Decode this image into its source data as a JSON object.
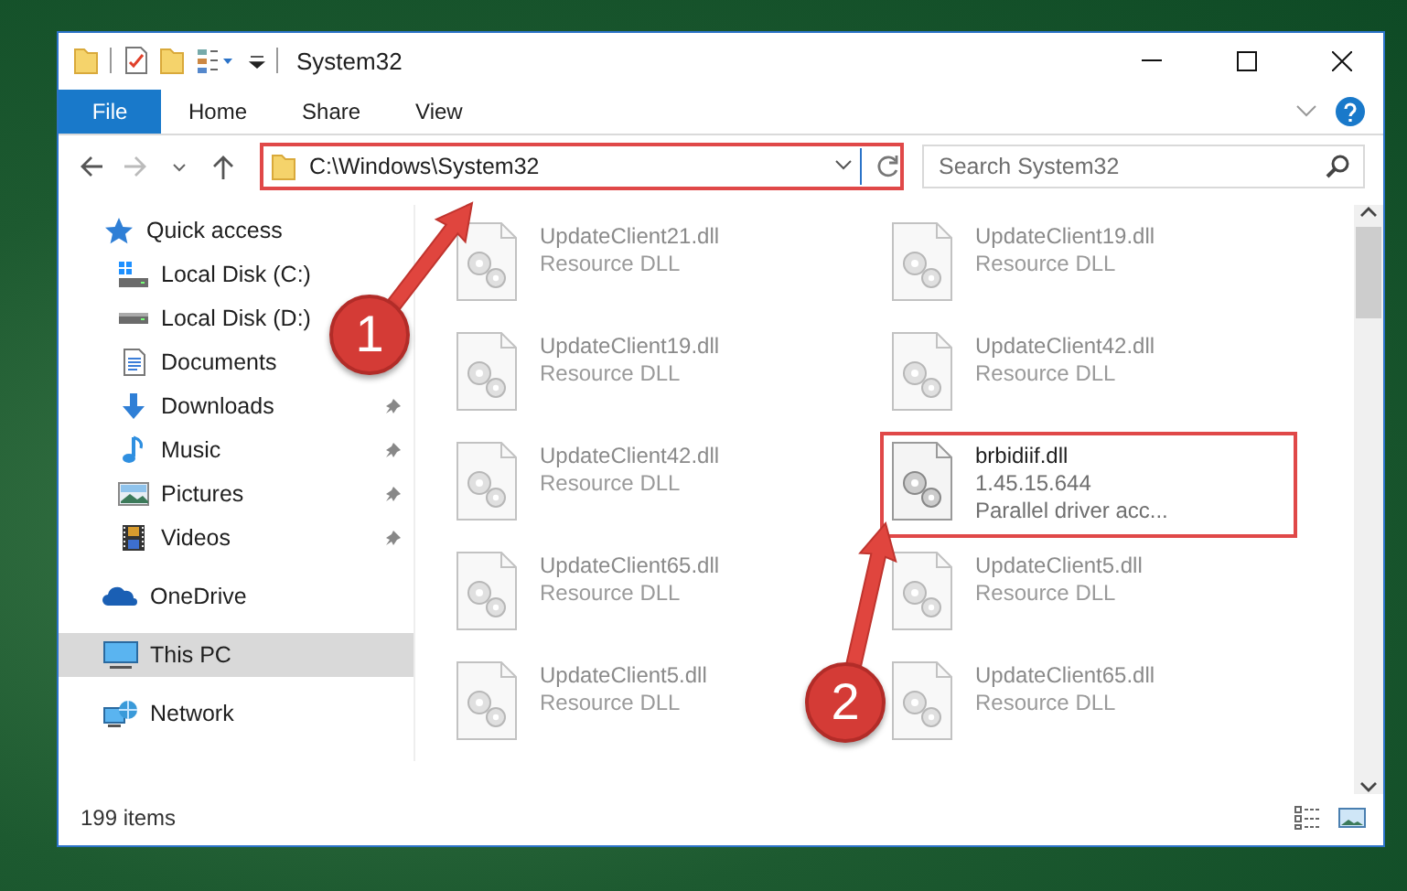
{
  "window": {
    "title": "System32"
  },
  "ribbon_tabs": [
    {
      "label": "File",
      "kind": "file",
      "selected": false
    },
    {
      "label": "Home",
      "kind": "tab",
      "selected": false
    },
    {
      "label": "Share",
      "kind": "tab",
      "selected": false
    },
    {
      "label": "View",
      "kind": "tab",
      "selected": false
    }
  ],
  "address": {
    "path": "C:\\Windows\\System32",
    "highlighted": true
  },
  "search": {
    "placeholder": "Search System32"
  },
  "nav": [
    {
      "label": "Quick access",
      "selected": false,
      "children": [
        {
          "label": "Local Disk (C:)",
          "pinned": false
        },
        {
          "label": "Local Disk (D:)",
          "pinned": false
        },
        {
          "label": "Documents",
          "pinned": false
        },
        {
          "label": "Downloads",
          "pinned": true
        },
        {
          "label": "Music",
          "pinned": true
        },
        {
          "label": "Pictures",
          "pinned": true
        },
        {
          "label": "Videos",
          "pinned": true
        }
      ]
    },
    {
      "label": "OneDrive",
      "selected": false
    },
    {
      "label": "This PC",
      "selected": true
    },
    {
      "label": "Network",
      "selected": false
    }
  ],
  "files": [
    {
      "name": "UpdateClient21.dll",
      "details": [
        "Resource DLL"
      ],
      "blurred": true,
      "highlighted": false
    },
    {
      "name": "UpdateClient19.dll",
      "details": [
        "Resource DLL"
      ],
      "blurred": true,
      "highlighted": false
    },
    {
      "name": "UpdateClient19.dll",
      "details": [
        "Resource DLL"
      ],
      "blurred": true,
      "highlighted": false
    },
    {
      "name": "UpdateClient42.dll",
      "details": [
        "Resource DLL"
      ],
      "blurred": true,
      "highlighted": false
    },
    {
      "name": "UpdateClient42.dll",
      "details": [
        "Resource DLL"
      ],
      "blurred": true,
      "highlighted": false
    },
    {
      "name": "brbidiif.dll",
      "details": [
        "1.45.15.644",
        "Parallel driver acc..."
      ],
      "blurred": false,
      "highlighted": true
    },
    {
      "name": "UpdateClient65.dll",
      "details": [
        "Resource DLL"
      ],
      "blurred": true,
      "highlighted": false
    },
    {
      "name": "UpdateClient5.dll",
      "details": [
        "Resource DLL"
      ],
      "blurred": true,
      "highlighted": false
    },
    {
      "name": "UpdateClient5.dll",
      "details": [
        "Resource DLL"
      ],
      "blurred": true,
      "highlighted": false
    },
    {
      "name": "UpdateClient65.dll",
      "details": [
        "Resource DLL"
      ],
      "blurred": true,
      "highlighted": false
    }
  ],
  "status_bar": {
    "count": "199 items"
  },
  "callouts": [
    {
      "number": "1"
    },
    {
      "number": "2"
    }
  ]
}
